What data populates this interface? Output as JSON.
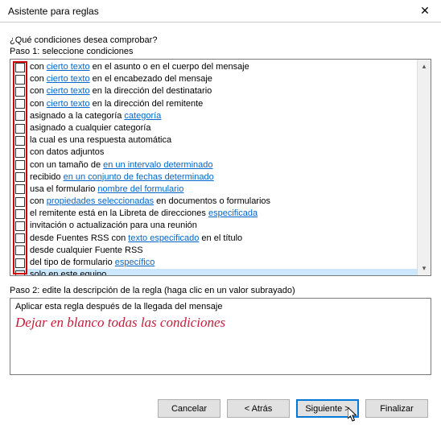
{
  "titlebar": {
    "title": "Asistente para reglas"
  },
  "question": "¿Qué condiciones desea comprobar?",
  "step1_label": "Paso 1: seleccione condiciones",
  "conditions": [
    {
      "prefix": "con ",
      "link": "cierto texto",
      "suffix": " en el asunto o en el cuerpo del mensaje"
    },
    {
      "prefix": "con ",
      "link": "cierto texto",
      "suffix": " en el encabezado del mensaje"
    },
    {
      "prefix": "con ",
      "link": "cierto texto",
      "suffix": " en la dirección del destinatario"
    },
    {
      "prefix": "con ",
      "link": "cierto texto",
      "suffix": " en la dirección del remitente"
    },
    {
      "prefix": "asignado a la categoría ",
      "link": "categoría",
      "suffix": ""
    },
    {
      "prefix": "asignado a cualquier categoría",
      "link": "",
      "suffix": ""
    },
    {
      "prefix": "la cual es una respuesta automática",
      "link": "",
      "suffix": ""
    },
    {
      "prefix": "con datos adjuntos",
      "link": "",
      "suffix": ""
    },
    {
      "prefix": "con un tamaño de ",
      "link": "en un intervalo determinado",
      "suffix": ""
    },
    {
      "prefix": "recibido ",
      "link": "en un conjunto de fechas determinado",
      "suffix": ""
    },
    {
      "prefix": "usa el formulario ",
      "link": "nombre del formulario",
      "suffix": ""
    },
    {
      "prefix": "con ",
      "link": "propiedades seleccionadas",
      "suffix": " en documentos o formularios"
    },
    {
      "prefix": "el remitente está en la Libreta de direcciones ",
      "link": "especificada",
      "suffix": ""
    },
    {
      "prefix": "invitación o actualización para una reunión",
      "link": "",
      "suffix": ""
    },
    {
      "prefix": "desde Fuentes RSS con ",
      "link": "texto especificado",
      "suffix": " en el título"
    },
    {
      "prefix": "desde cualquier Fuente RSS",
      "link": "",
      "suffix": ""
    },
    {
      "prefix": "del tipo de formulario ",
      "link": "específico",
      "suffix": ""
    },
    {
      "prefix": "solo en este equipo",
      "link": "",
      "suffix": "",
      "selected": true
    }
  ],
  "step2_label": "Paso 2: edite la descripción de la regla (haga clic en un valor subrayado)",
  "description_line": "Aplicar esta regla después de la llegada del mensaje",
  "annotation": "Dejar en blanco todas las condiciones",
  "buttons": {
    "cancel": "Cancelar",
    "back": "< Atrás",
    "next": "Siguiente >",
    "finish": "Finalizar"
  }
}
